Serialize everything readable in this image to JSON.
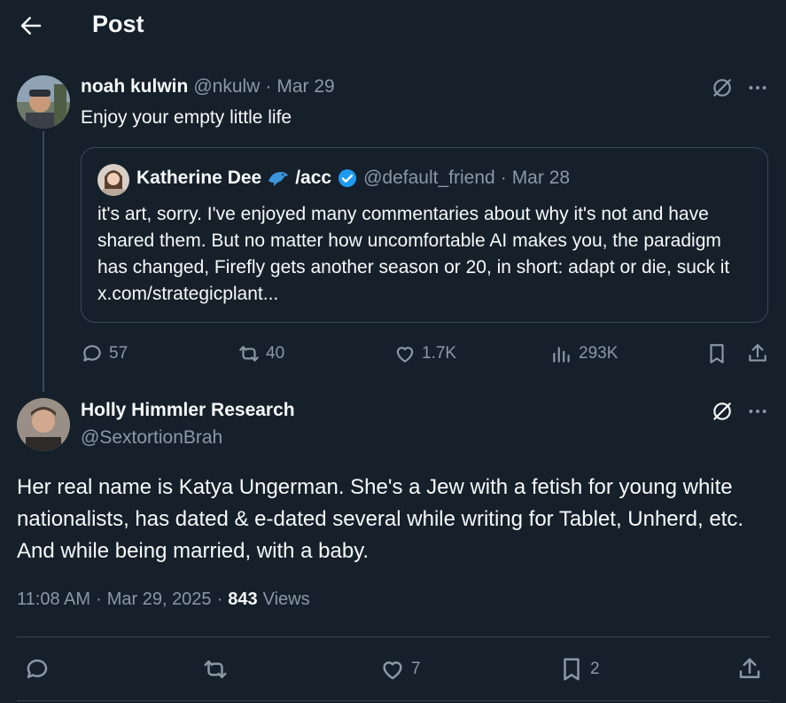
{
  "header": {
    "title": "Post"
  },
  "reply_to": {
    "name": "noah kulwin",
    "handle": "@nkulw",
    "separator": "·",
    "date": "Mar 29",
    "text": "Enjoy your empty little life",
    "quote": {
      "name": "Katherine Dee",
      "name_suffix": "/acc",
      "handle": "@default_friend",
      "separator": "·",
      "date": "Mar 28",
      "text": "it's art, sorry. I've enjoyed many commentaries about why it's not and have shared them. But no matter how uncomfortable AI makes you, the paradigm has changed, Firefly gets another season or 20, in short: adapt or die, suck it x.com/strategicplant..."
    },
    "actions": {
      "replies": "57",
      "reposts": "40",
      "likes": "1.7K",
      "views": "293K"
    }
  },
  "post": {
    "name": "Holly Himmler Research",
    "handle": "@SextortionBrah",
    "text": "Her real name is Katya Ungerman. She's a Jew with a fetish for young white nationalists, has dated & e-dated several while writing for Tablet, Unherd, etc. And while being married, with a baby.",
    "time": "11:08 AM",
    "separator": "·",
    "date": "Mar 29, 2025",
    "separator2": "·",
    "views_count": "843",
    "views_label": "Views",
    "actions": {
      "likes": "7",
      "bookmarks": "2"
    }
  },
  "colors": {
    "background": "#15202b",
    "text": "#f7f9f9",
    "muted": "#8b98a5",
    "verified": "#1d9bf0",
    "border": "#38444d"
  }
}
